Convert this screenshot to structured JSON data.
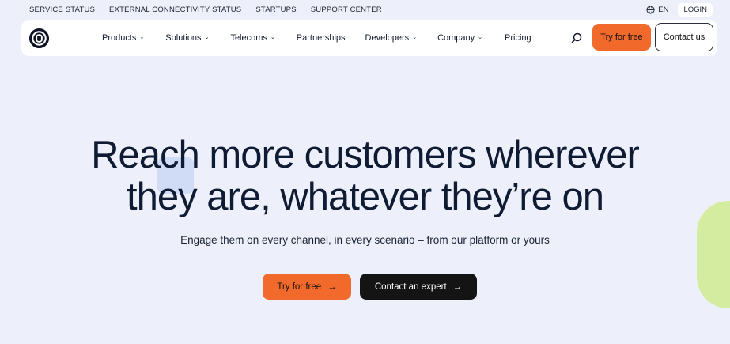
{
  "utility": {
    "links": [
      "SERVICE STATUS",
      "EXTERNAL CONNECTIVITY STATUS",
      "STARTUPS",
      "SUPPORT CENTER"
    ],
    "lang": "EN",
    "login": "LOGIN"
  },
  "nav": {
    "items": [
      {
        "label": "Products",
        "dropdown": true
      },
      {
        "label": "Solutions",
        "dropdown": true
      },
      {
        "label": "Telecoms",
        "dropdown": true
      },
      {
        "label": "Partnerships",
        "dropdown": false
      },
      {
        "label": "Developers",
        "dropdown": true
      },
      {
        "label": "Company",
        "dropdown": true
      },
      {
        "label": "Pricing",
        "dropdown": false
      }
    ],
    "try_label": "Try for free",
    "contact_label": "Contact us"
  },
  "hero": {
    "title_line1": "Reach more customers wherever",
    "title_line2": "they are, whatever they’re on",
    "subtitle": "Engage them on every channel, in every scenario – from our platform or yours",
    "cta_primary": "Try for free",
    "cta_secondary": "Contact an expert",
    "arrow": "→"
  },
  "colors": {
    "accent": "#f26a2b",
    "background": "#edf0fa",
    "dark": "#141414",
    "deco_green": "#d4ec9f"
  }
}
